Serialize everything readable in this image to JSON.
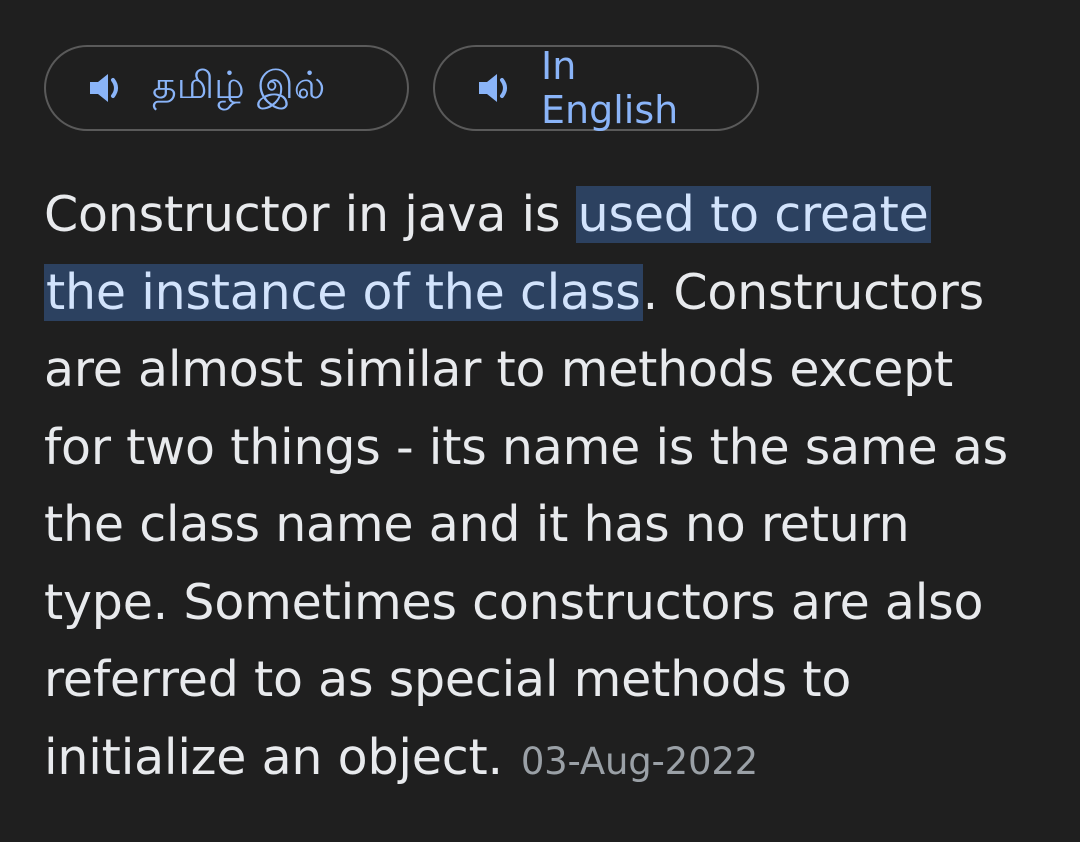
{
  "language_buttons": [
    {
      "label": "தமிழ் இல்",
      "icon": "speaker-icon"
    },
    {
      "label": "In English",
      "icon": "speaker-icon"
    }
  ],
  "snippet": {
    "line1_before": "Constructor in java is ",
    "line1_highlight": "used to create",
    "line2_highlight": "the instance of the class",
    "line2_after": ". Constructors",
    "line3": "are almost similar to methods except",
    "line4": "for two things - its name is the same as",
    "line5": "the class name and it has no return",
    "line6": "type. Sometimes constructors are also",
    "line7": "referred to as special methods to",
    "line8": "initialize an object.",
    "date": "03-Aug-2022"
  },
  "colors": {
    "background": "#1f1f1f",
    "link": "#8ab4f8",
    "highlight_bg": "#2c4160",
    "text": "#e8eaed",
    "muted": "#9aa0a6"
  }
}
